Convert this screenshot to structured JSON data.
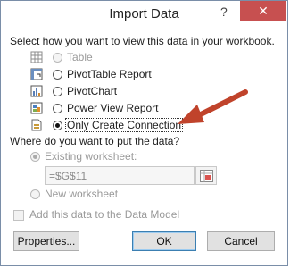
{
  "window": {
    "title": "Import Data",
    "help": "?",
    "close": "✕"
  },
  "view_prompt": "Select how you want to view this data in your workbook.",
  "view_options": [
    {
      "label": "Table",
      "selected": false,
      "enabled": false
    },
    {
      "label": "PivotTable Report",
      "selected": false,
      "enabled": true
    },
    {
      "label": "PivotChart",
      "selected": false,
      "enabled": true
    },
    {
      "label": "Power View Report",
      "selected": false,
      "enabled": true
    },
    {
      "label": "Only Create Connection",
      "selected": true,
      "enabled": true
    }
  ],
  "where_prompt": "Where do you want to put the data?",
  "where_options": [
    {
      "label": "Existing worksheet:",
      "selected": true,
      "enabled": false
    },
    {
      "label": "New worksheet",
      "selected": false,
      "enabled": false
    }
  ],
  "range_value": "=$G$11",
  "data_model_label": "Add this data to the Data Model",
  "buttons": {
    "properties": "Properties...",
    "ok": "OK",
    "cancel": "Cancel"
  },
  "annotation_color": "#c0432b"
}
